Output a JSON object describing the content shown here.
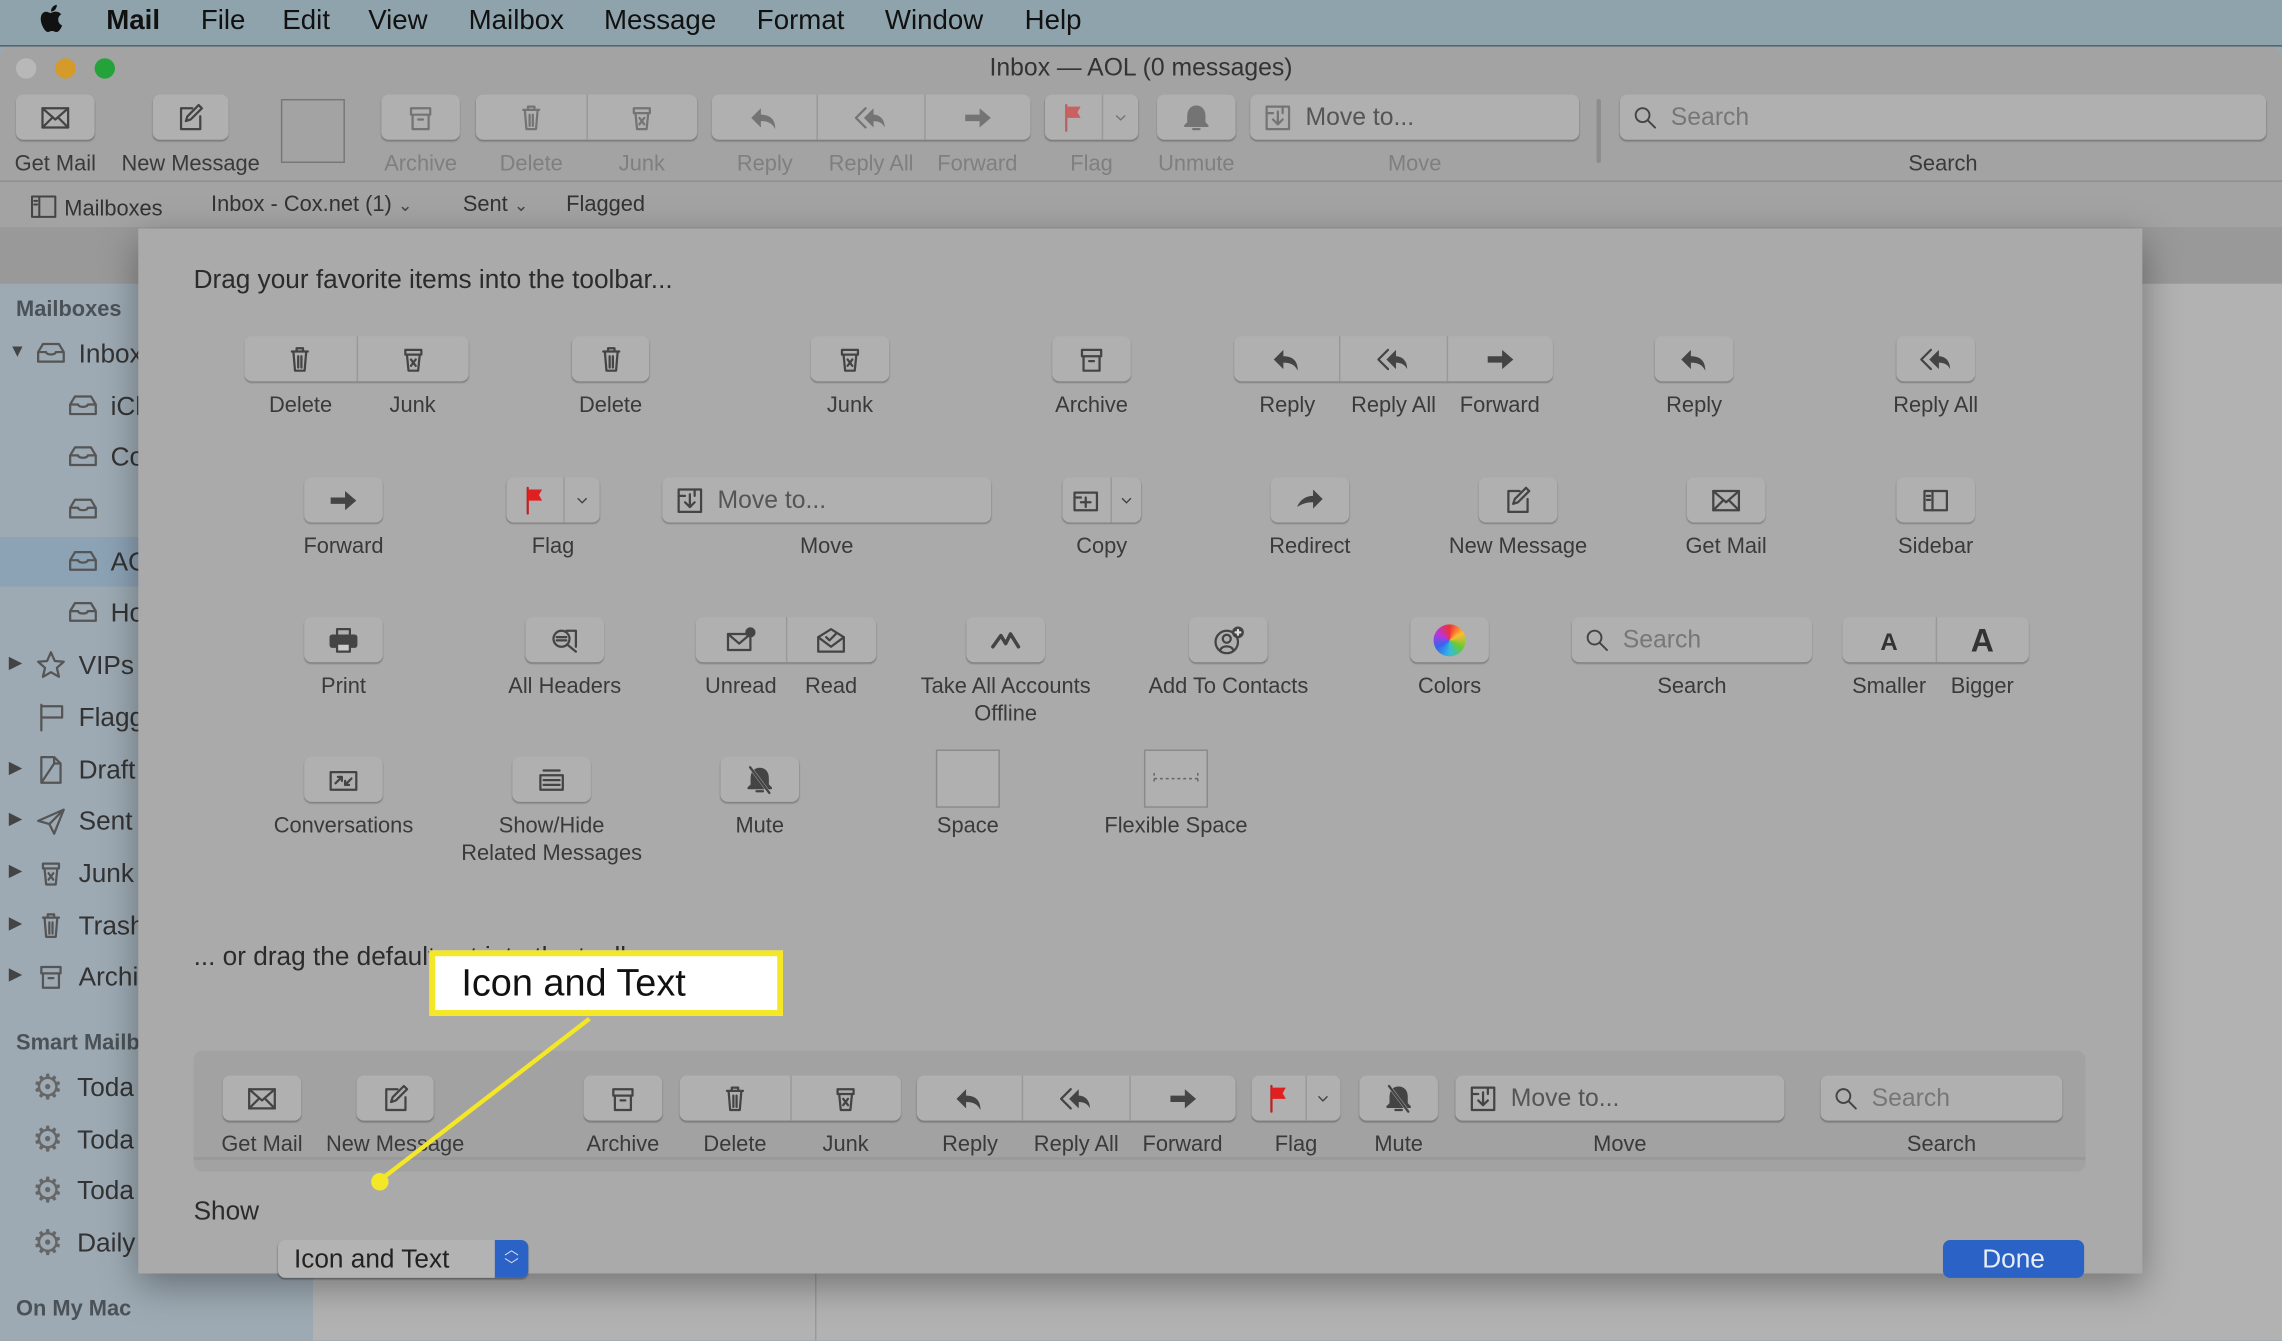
{
  "menubar": {
    "app": "Mail",
    "items": [
      "File",
      "Edit",
      "View",
      "Mailbox",
      "Message",
      "Format",
      "Window",
      "Help"
    ]
  },
  "window": {
    "title": "Inbox — AOL (0 messages)"
  },
  "toolbar": {
    "items": [
      {
        "labels": [
          "Get Mail"
        ],
        "icons": [
          "envelope"
        ]
      },
      {
        "labels": [
          "New Message"
        ],
        "icons": [
          "compose"
        ]
      },
      {
        "kind": "space"
      },
      {
        "labels": [
          "Archive"
        ],
        "icons": [
          "archive"
        ],
        "disabled": true
      },
      {
        "labels": [
          "Delete",
          "Junk"
        ],
        "icons": [
          "trash",
          "junk"
        ],
        "disabled": true
      },
      {
        "labels": [
          "Reply",
          "Reply All",
          "Forward"
        ],
        "icons": [
          "reply",
          "replyall",
          "forward"
        ],
        "disabled": true
      },
      {
        "kind": "flag",
        "labels": [
          "Flag"
        ],
        "disabled": true
      },
      {
        "labels": [
          "Unmute"
        ],
        "icons": [
          "bell"
        ],
        "disabled": true
      },
      {
        "kind": "move",
        "text": "Move to...",
        "labels": [
          "Move"
        ],
        "disabled": true
      },
      {
        "kind": "search",
        "text": "Search",
        "labels": [
          "Search"
        ]
      }
    ]
  },
  "favorites_bar": {
    "mailboxes": "Mailboxes",
    "inbox": "Inbox - Cox.net (1)",
    "sent": "Sent",
    "flagged": "Flagged"
  },
  "sidebar": {
    "header": "Mailboxes",
    "items": [
      {
        "label": "Inbox",
        "icon": "inbox-icon"
      },
      {
        "label": "iCl",
        "icon": "inbox-icon"
      },
      {
        "label": "Co",
        "icon": "inbox-icon"
      },
      {
        "label": "",
        "icon": "inbox-icon"
      },
      {
        "label": "AO",
        "icon": "inbox-icon",
        "selected": true
      },
      {
        "label": "Ho",
        "icon": "inbox-icon"
      },
      {
        "label": "VIPs",
        "icon": "star-icon"
      },
      {
        "label": "Flagg",
        "icon": "flag-icon"
      },
      {
        "label": "Draft",
        "icon": "draft-icon"
      },
      {
        "label": "Sent",
        "icon": "sent-icon"
      },
      {
        "label": "Junk",
        "icon": "junk-icon"
      },
      {
        "label": "Trash",
        "icon": "trash-icon"
      },
      {
        "label": "Archi",
        "icon": "archive-icon"
      }
    ],
    "smart_header": "Smart Mailb",
    "smart_items": [
      "Toda",
      "Toda",
      "Toda",
      "Daily"
    ],
    "onmymac_header": "On My Mac"
  },
  "sheet": {
    "heading": "Drag your favorite items into the toolbar...",
    "default_heading": "... or drag the default set into the toolbar.",
    "palette": [
      {
        "labels": [
          "Delete",
          "Junk"
        ],
        "icons": [
          "trash",
          "junk"
        ]
      },
      {
        "labels": [
          "Delete"
        ],
        "icons": [
          "trash"
        ]
      },
      {
        "labels": [
          "Junk"
        ],
        "icons": [
          "junk"
        ]
      },
      {
        "labels": [
          "Archive"
        ],
        "icons": [
          "archive"
        ]
      },
      {
        "labels": [
          "Reply",
          "Reply All",
          "Forward"
        ],
        "icons": [
          "reply",
          "replyall",
          "forward"
        ]
      },
      {
        "labels": [
          "Reply"
        ],
        "icons": [
          "reply"
        ]
      },
      {
        "labels": [
          "Reply All"
        ],
        "icons": [
          "replyall"
        ]
      },
      {
        "labels": [
          "Forward"
        ],
        "icons": [
          "forward"
        ]
      },
      {
        "kind": "flag",
        "labels": [
          "Flag"
        ]
      },
      {
        "kind": "move",
        "text": "Move to...",
        "labels": [
          "Move"
        ]
      },
      {
        "kind": "copy",
        "labels": [
          "Copy"
        ]
      },
      {
        "labels": [
          "Redirect"
        ],
        "icons": [
          "redirect"
        ]
      },
      {
        "labels": [
          "New Message"
        ],
        "icons": [
          "compose"
        ]
      },
      {
        "labels": [
          "Get Mail"
        ],
        "icons": [
          "envelope"
        ]
      },
      {
        "labels": [
          "Sidebar"
        ],
        "icons": [
          "sidebar"
        ]
      },
      {
        "labels": [
          "Print"
        ],
        "icons": [
          "print"
        ]
      },
      {
        "labels": [
          "All Headers"
        ],
        "icons": [
          "headers"
        ]
      },
      {
        "labels": [
          "Unread",
          "Read"
        ],
        "icons": [
          "unread",
          "read"
        ]
      },
      {
        "labels": [
          "Take All Accounts\nOffline"
        ],
        "icons": [
          "offline"
        ]
      },
      {
        "labels": [
          "Add To Contacts"
        ],
        "icons": [
          "contacts"
        ]
      },
      {
        "labels": [
          "Colors"
        ],
        "icons": [
          "colors"
        ]
      },
      {
        "kind": "search",
        "text": "Search",
        "labels": [
          "Search"
        ]
      },
      {
        "labels": [
          "Smaller",
          "Bigger"
        ],
        "icons": [
          "smaller",
          "bigger"
        ]
      },
      {
        "labels": [
          "Conversations"
        ],
        "icons": [
          "conversations"
        ]
      },
      {
        "labels": [
          "Show/Hide\nRelated Messages"
        ],
        "icons": [
          "related"
        ]
      },
      {
        "labels": [
          "Mute"
        ],
        "icons": [
          "bellslash"
        ]
      },
      {
        "kind": "space",
        "labels": [
          "Space"
        ]
      },
      {
        "kind": "flex",
        "labels": [
          "Flexible Space"
        ]
      }
    ],
    "default_set": [
      {
        "labels": [
          "Get Mail"
        ],
        "icons": [
          "envelope"
        ]
      },
      {
        "labels": [
          "New Message"
        ],
        "icons": [
          "compose"
        ]
      },
      {
        "labels": [
          "Archive"
        ],
        "icons": [
          "archive"
        ]
      },
      {
        "labels": [
          "Delete",
          "Junk"
        ],
        "icons": [
          "trash",
          "junk"
        ]
      },
      {
        "labels": [
          "Reply",
          "Reply All",
          "Forward"
        ],
        "icons": [
          "reply",
          "replyall",
          "forward"
        ]
      },
      {
        "kind": "flag",
        "labels": [
          "Flag"
        ]
      },
      {
        "labels": [
          "Mute"
        ],
        "icons": [
          "bellslash"
        ]
      },
      {
        "kind": "move",
        "text": "Move to...",
        "labels": [
          "Move"
        ]
      },
      {
        "kind": "search",
        "text": "Search",
        "labels": [
          "Search"
        ]
      }
    ],
    "show_label": "Show",
    "show_value": "Icon and Text",
    "done_label": "Done"
  },
  "callout": {
    "text": "Icon and Text",
    "color": "#f3e727"
  },
  "colors": {
    "accent": "#2a62c6",
    "flag": "#e02020"
  }
}
